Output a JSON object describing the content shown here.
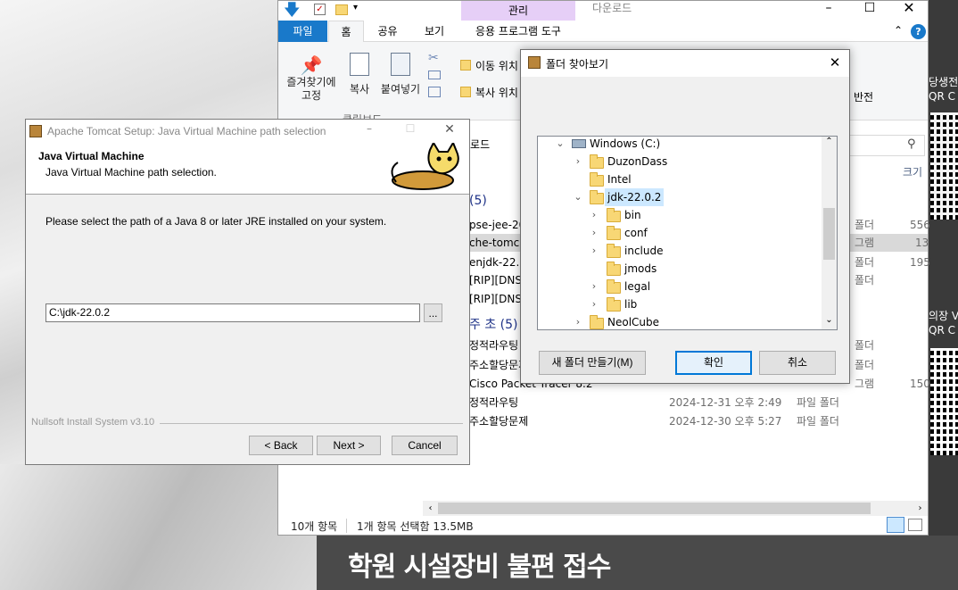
{
  "explorer": {
    "title": "다운로드",
    "manage_tab": "관리",
    "tabs": [
      "파일",
      "홈",
      "공유",
      "보기",
      "응용 프로그램 도구"
    ],
    "ribbon": {
      "pin_label": "즐겨찾기에\n고정",
      "copy_label": "복사",
      "paste_label": "붙여넣기",
      "move_to_label": "이동 위치",
      "copy_to_label": "복사 위치",
      "clipboard_group": "클립보드",
      "invert_label": "반전"
    },
    "address_path": "운로드",
    "size_header": "크기",
    "groups": {
      "g1": "(5)",
      "g2": "주 초 (5)"
    },
    "rows_top": [
      {
        "name": "pse-jee-20",
        "type": "폴더",
        "size": "556"
      },
      {
        "name": "che-tomca",
        "type": "그램",
        "size": "13"
      },
      {
        "name": "enjdk-22.0.",
        "type": "폴더",
        "size": "195"
      },
      {
        "name": "[RIP][DNS",
        "type": "폴더",
        "size": ""
      },
      {
        "name": "[RIP][DNS",
        "type": "",
        "size": ""
      }
    ],
    "rows_bottom": [
      {
        "name": "정적라우팅",
        "date": "",
        "type": "폴더",
        "size": ""
      },
      {
        "name": "주소할당문제",
        "date": "",
        "type": "폴더",
        "size": ""
      },
      {
        "name": "Cisco Packet Tracer 8.2",
        "date": "",
        "type": "그램",
        "size": "150"
      },
      {
        "name": "정적라우팅",
        "date": "2024-12-31 오후 2:49",
        "type": "파일 폴더",
        "size": ""
      },
      {
        "name": "주소할당문제",
        "date": "2024-12-30 오후 5:27",
        "type": "파일 폴더",
        "size": ""
      }
    ],
    "status_count": "10개 항목",
    "status_selected": "1개 항목 선택함 13.5MB"
  },
  "tomcat": {
    "title": "Apache Tomcat Setup: Java Virtual Machine path selection",
    "heading": "Java Virtual Machine",
    "subheading": "Java Virtual Machine path selection.",
    "instruction": "Please select the path of a Java 8 or later JRE installed on your system.",
    "path_value": "C:\\jdk-22.0.2",
    "browse_label": "...",
    "branding": "Nullsoft Install System v3.10",
    "back_label": "< Back",
    "next_label": "Next >",
    "cancel_label": "Cancel"
  },
  "folder_dialog": {
    "title": "폴더 찾아보기",
    "tree": [
      {
        "label": "Windows (C:)",
        "depth": 0,
        "expanded": true,
        "has_children": true,
        "drive": true
      },
      {
        "label": "DuzonDass",
        "depth": 1,
        "has_children": true
      },
      {
        "label": "Intel",
        "depth": 1,
        "has_children": false
      },
      {
        "label": "jdk-22.0.2",
        "depth": 1,
        "expanded": true,
        "has_children": true,
        "selected": true
      },
      {
        "label": "bin",
        "depth": 2,
        "has_children": true
      },
      {
        "label": "conf",
        "depth": 2,
        "has_children": true
      },
      {
        "label": "include",
        "depth": 2,
        "has_children": true
      },
      {
        "label": "jmods",
        "depth": 2,
        "has_children": false
      },
      {
        "label": "legal",
        "depth": 2,
        "has_children": true
      },
      {
        "label": "lib",
        "depth": 2,
        "has_children": true
      },
      {
        "label": "NeolCube",
        "depth": 1,
        "has_children": true
      }
    ],
    "new_folder_label": "새 폴더 만들기(M)",
    "ok_label": "확인",
    "cancel_label": "취소"
  },
  "background": {
    "banner_text": "학원 시설장비 불편 접수",
    "qr_label_1": "당생전\nQR C",
    "qr_label_2": "의장 V\nQR C"
  },
  "colors": {
    "accent": "#1979ca",
    "selection": "#cce8ff",
    "manage_tab": "#e6cff7"
  }
}
